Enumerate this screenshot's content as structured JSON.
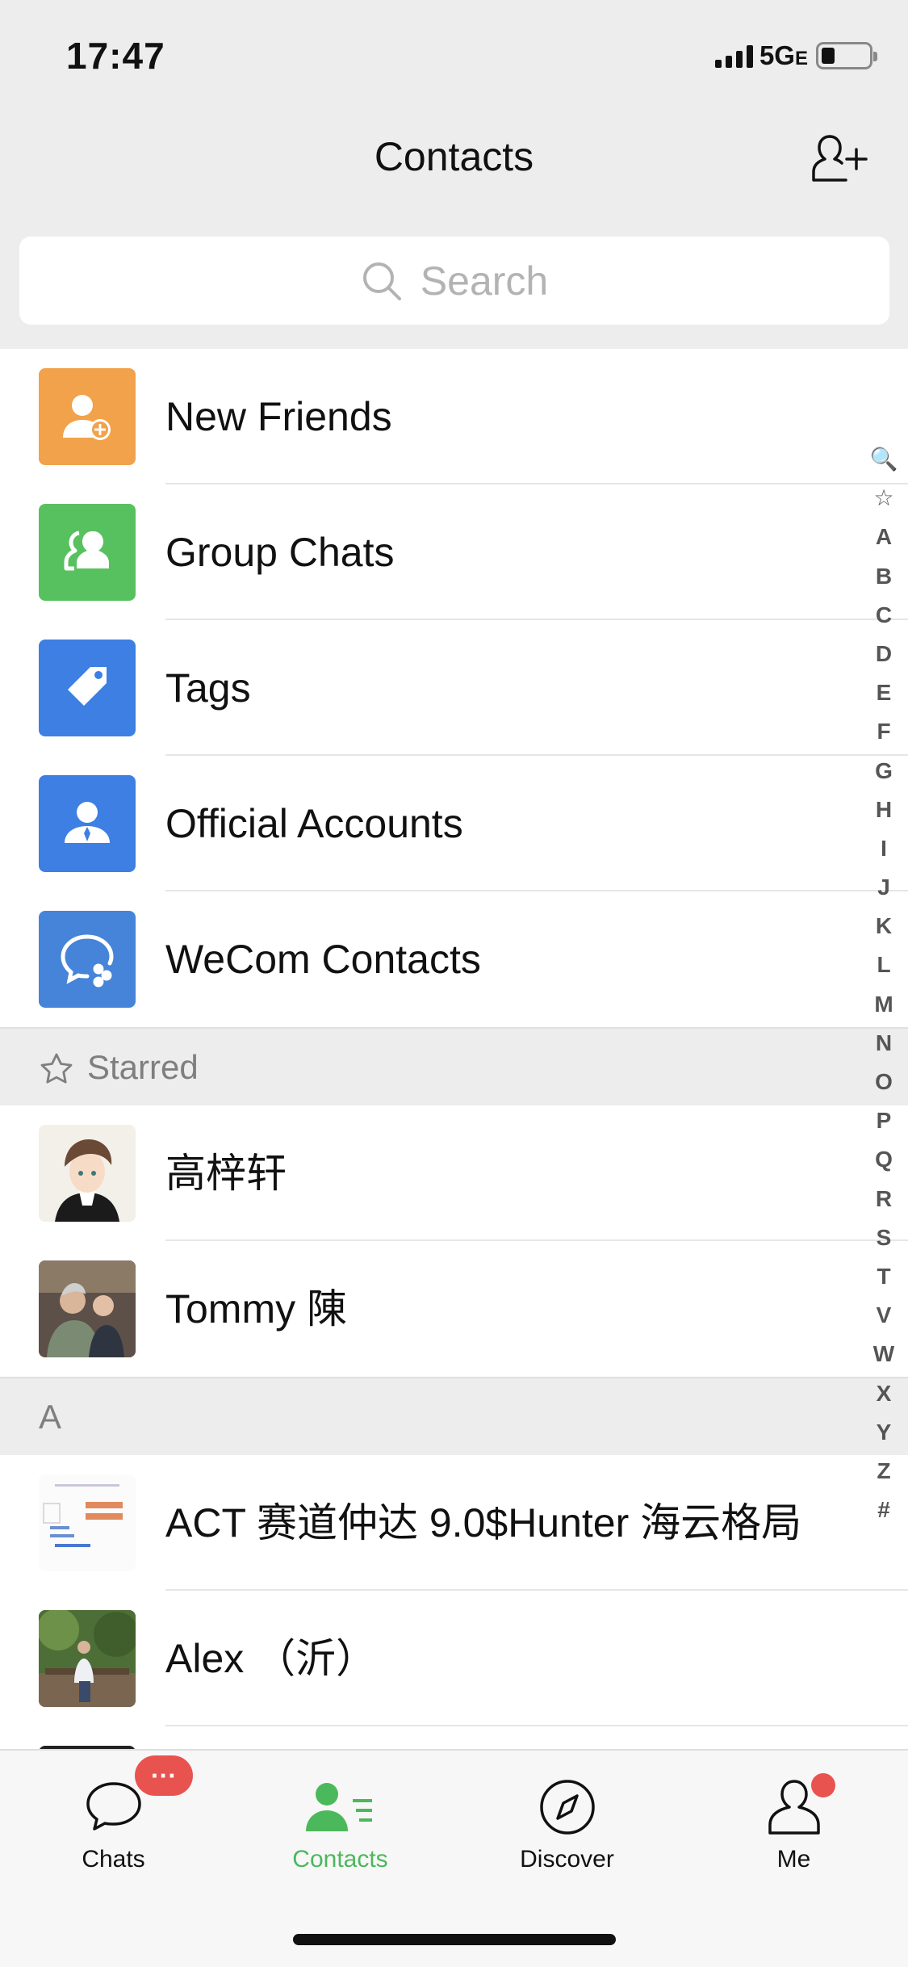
{
  "status": {
    "time": "17:47",
    "network": "5G",
    "network_suffix": "E"
  },
  "header": {
    "title": "Contacts"
  },
  "search": {
    "placeholder": "Search"
  },
  "menu": [
    {
      "label": "New Friends",
      "icon": "add-friend-icon",
      "color": "#f1a24a"
    },
    {
      "label": "Group Chats",
      "icon": "group-icon",
      "color": "#58c15f"
    },
    {
      "label": "Tags",
      "icon": "tag-icon",
      "color": "#3d7fe3"
    },
    {
      "label": "Official Accounts",
      "icon": "official-account-icon",
      "color": "#3d7fe3"
    },
    {
      "label": "WeCom Contacts",
      "icon": "wecom-icon",
      "color": "#4584d8"
    }
  ],
  "sections": {
    "starred": {
      "label": "Starred",
      "contacts": [
        "高梓轩",
        "Tommy 陳"
      ]
    },
    "a": {
      "label": "A",
      "contacts": [
        "ACT 赛道仲达 9.0$Hunter 海云格局",
        "Alex （沂）"
      ]
    }
  },
  "index": [
    "🔍",
    "☆",
    "A",
    "B",
    "C",
    "D",
    "E",
    "F",
    "G",
    "H",
    "I",
    "J",
    "K",
    "L",
    "M",
    "N",
    "O",
    "P",
    "Q",
    "R",
    "S",
    "T",
    "V",
    "W",
    "X",
    "Y",
    "Z",
    "#"
  ],
  "tabs": [
    {
      "label": "Chats",
      "badge": "···"
    },
    {
      "label": "Contacts",
      "active": true
    },
    {
      "label": "Discover"
    },
    {
      "label": "Me",
      "dot": true
    }
  ],
  "colors": {
    "accent": "#4cb85c",
    "badge": "#e9534f"
  }
}
